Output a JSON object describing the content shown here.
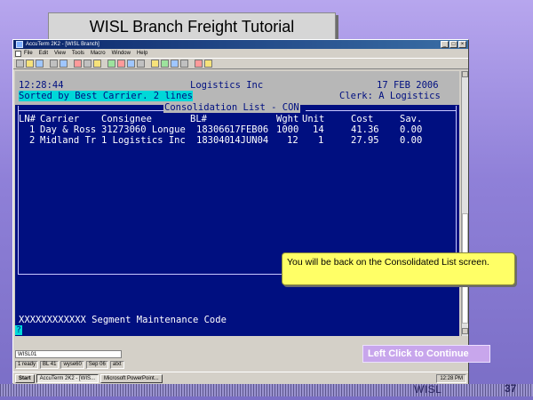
{
  "slide": {
    "title": "WISL Branch Freight Tutorial",
    "footer_label": "WISL",
    "page_number": "37"
  },
  "window": {
    "title": "AccuTerm 2K2 - [WISL Branch]",
    "buttons": [
      "_",
      "□",
      "×"
    ],
    "menu": [
      "File",
      "Edit",
      "View",
      "Tools",
      "Macro",
      "Window",
      "Help"
    ]
  },
  "terminal": {
    "time": "12:28:44",
    "company": "Logistics Inc",
    "date": "17 FEB 2006",
    "sort_status": "Sorted by Best Carrier. 2 lines",
    "clerk": "Clerk: A Logistics",
    "list_title": "Consolidation List - CON",
    "columns": [
      "LN#",
      "Carrier",
      "Consignee",
      "BL#",
      "",
      "Wght",
      "Unit",
      "Cost",
      "Sav."
    ],
    "rows": [
      {
        "ln": "1",
        "carrier": "Day & Ross",
        "consignee": "31273060 Longue",
        "bl": "183066",
        "date": "17FEB06",
        "wght": "1000",
        "unit": "14",
        "cost": "41.36",
        "sav": "0.00"
      },
      {
        "ln": "2",
        "carrier": "Midland Tr",
        "consignee": "1 Logistics Inc",
        "bl": "183040",
        "date": "14JUN04",
        "wght": "12",
        "unit": "1",
        "cost": "27.95",
        "sav": "0.00"
      }
    ],
    "prompt": "XXXXXXXXXXXX Segment Maintenance Code",
    "cursor": "?"
  },
  "statusbar": {
    "command": "WISL01",
    "cells": [
      "1 ready",
      "BL 41",
      "wyse60",
      "Sep 06",
      "atxt"
    ]
  },
  "taskbar": {
    "start": "Start",
    "tasks": [
      "AccuTerm 2K2 - [WIS...",
      "Microsoft PowerPoint..."
    ],
    "clock": "12:28 PM"
  },
  "callout": {
    "text": "You will be back on the Consolidated List screen."
  },
  "continue": {
    "label": "Left Click to Continue"
  }
}
